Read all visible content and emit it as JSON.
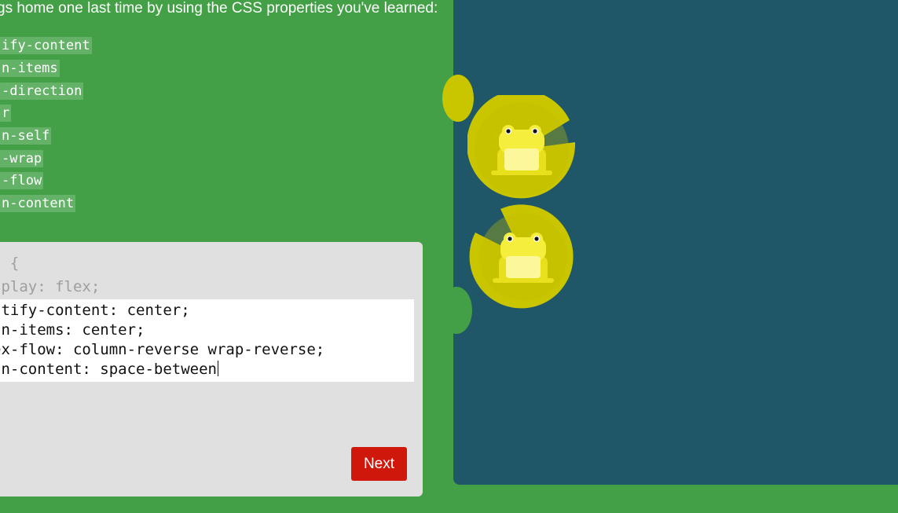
{
  "intro_text": "gs home one last time by using the CSS properties you've learned:",
  "properties": [
    "ify-content",
    "n-items",
    "-direction",
    "r",
    "n-self",
    "-wrap",
    "-flow",
    "n-content"
  ],
  "editor": {
    "static_lines": [
      "d {",
      "splay: flex;"
    ],
    "input_lines": [
      "stify-content: center;",
      "gn-items: center;",
      "ex-flow: column-reverse wrap-reverse;",
      "gn-content: space-between"
    ],
    "next_label": "Next"
  },
  "board": {
    "frogs": [
      "yellow-frog",
      "yellow-frog"
    ],
    "lilypads": [
      "yellow-lilypad",
      "yellow-lilypad"
    ]
  },
  "colors": {
    "background_green": "#43a047",
    "pond": "#1f5768",
    "editor_bg": "#e0e0e0",
    "next_button": "#d0170c",
    "lilypad_yellow": "#c9c600",
    "frog_yellow": "#f5ee3c"
  }
}
